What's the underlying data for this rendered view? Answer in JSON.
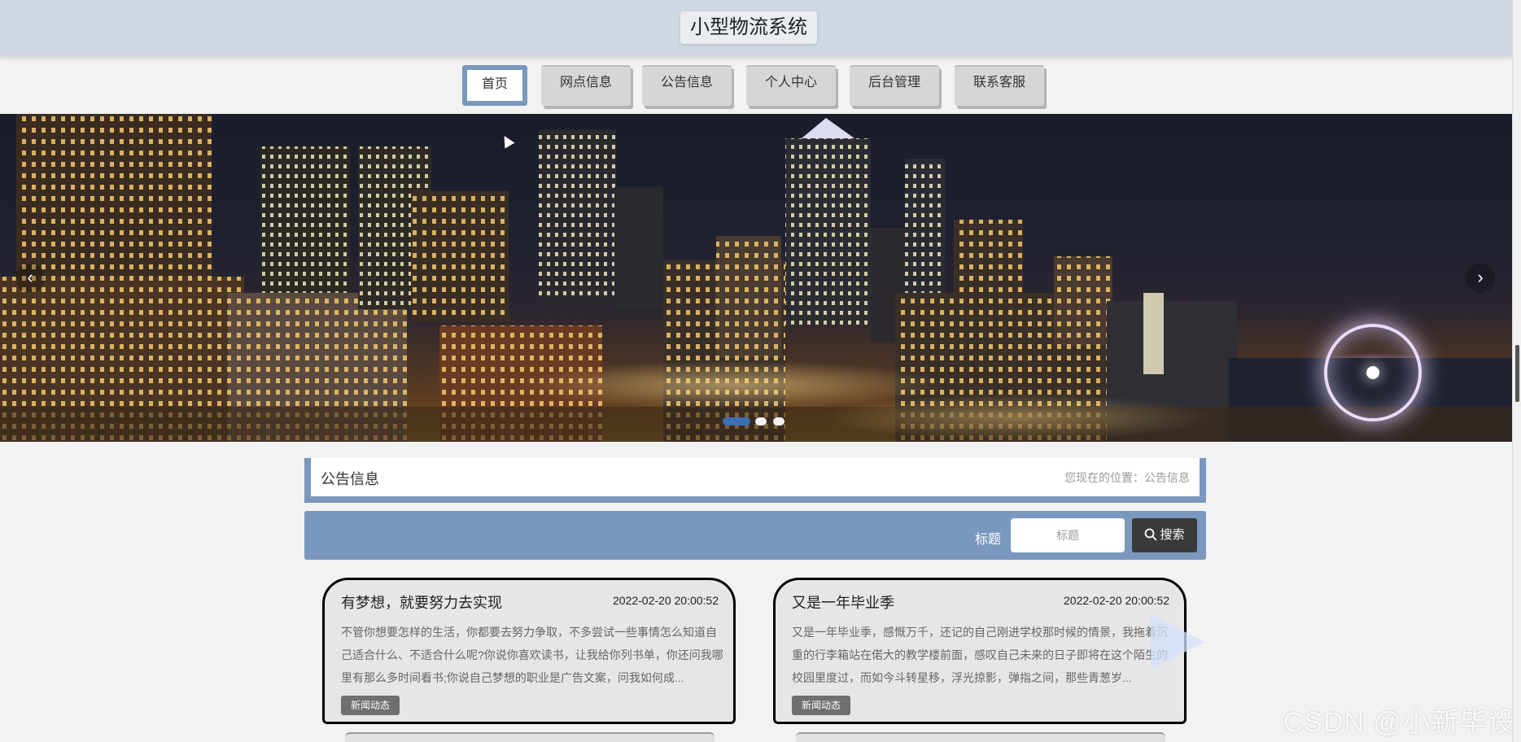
{
  "header": {
    "title": "小型物流系统"
  },
  "nav": {
    "items": [
      {
        "label": "首页",
        "active": true
      },
      {
        "label": "网点信息",
        "active": false
      },
      {
        "label": "公告信息",
        "active": false
      },
      {
        "label": "个人中心",
        "active": false
      },
      {
        "label": "后台管理",
        "active": false
      },
      {
        "label": "联系客服",
        "active": false
      }
    ]
  },
  "carousel": {
    "prev_icon": "chevron-left-icon",
    "next_icon": "chevron-right-icon",
    "prev_glyph": "‹",
    "next_glyph": "›",
    "slide_count": 3,
    "active_slide": 1
  },
  "breadcrumb": {
    "title": "公告信息",
    "location": "您现在的位置：公告信息"
  },
  "search": {
    "label": "标题",
    "placeholder": "标题",
    "button_label": "搜索",
    "button_icon": "search-icon"
  },
  "cards": [
    {
      "title": "有梦想，就要努力去实现",
      "date": "2022-02-20 20:00:52",
      "excerpt": "不管你想要怎样的生活，你都要去努力争取，不多尝试一些事情怎么知道自己适合什么、不适合什么呢?你说你喜欢读书，让我给你列书单，你还问我哪里有那么多时间看书;你说自己梦想的职业是广告文案，问我如何成...",
      "tag": "新闻动态"
    },
    {
      "title": "又是一年毕业季",
      "date": "2022-02-20 20:00:52",
      "excerpt": "又是一年毕业季，感慨万千，还记的自己刚进学校那时候的情景，我拖着沉重的行李箱站在偌大的教学楼前面，感叹自己未来的日子即将在这个陌生的校园里度过，而如今斗转星移，浮光掠影，弹指之间，那些青葱岁...",
      "tag": "新闻动态"
    }
  ],
  "watermark": "CSDN @小新毕设",
  "colors": {
    "accent": "#7a98bd",
    "header_bg": "#cfd8e2",
    "dark_button": "#3a3a3a"
  }
}
